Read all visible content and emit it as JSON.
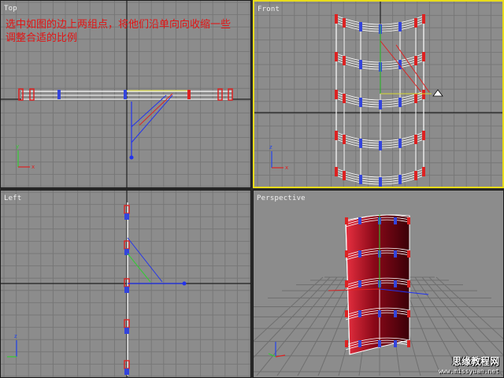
{
  "viewports": {
    "top": {
      "label": "Top"
    },
    "front": {
      "label": "Front"
    },
    "left": {
      "label": "Left"
    },
    "perspective": {
      "label": "Perspective"
    }
  },
  "instruction": {
    "line1": "选中如图的边上两组点，将他们沿单向向收缩一些",
    "line2": "调整合适的比例"
  },
  "watermark": {
    "title": "思缘教程网",
    "url": "www.missyuan.net"
  },
  "axes": {
    "x": "x",
    "y": "y",
    "z": "z"
  },
  "colors": {
    "viewport_bg": "#8c8c8c",
    "active_border": "#e8dc1a",
    "annotation": "#e21414",
    "mesh": "#ffffff",
    "vertex_red": "#dd2222",
    "vertex_blue": "#3344dd",
    "object_fill": "#9a1020"
  }
}
